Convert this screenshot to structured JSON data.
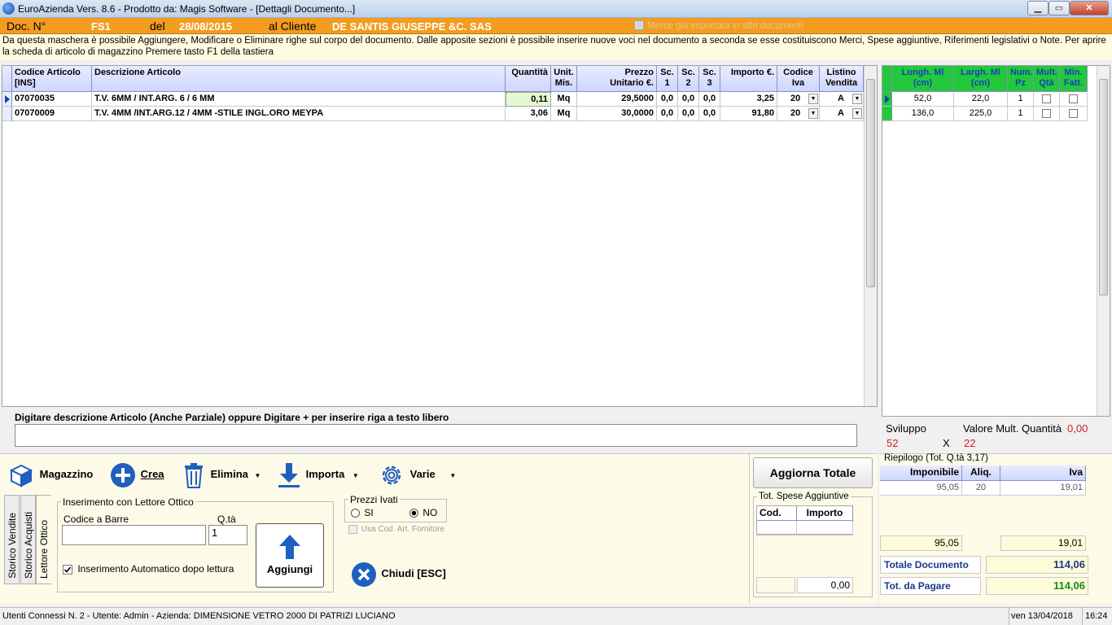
{
  "window": {
    "title": "EuroAzienda Vers. 8.6 - Prodotto da: Magis Software - [Dettagli Documento...]",
    "min_glyph": "▁",
    "max_glyph": "▭",
    "close_glyph": "✕"
  },
  "header": {
    "doc_label": "Doc. N°",
    "doc_number": "FS1",
    "del_label": "del",
    "date": "28/08/2015",
    "cliente_label": "al Cliente",
    "cliente": "DE SANTIS GIUSEPPE &C. SAS",
    "merce_label": "Merce già importata in altri documenti"
  },
  "info": "Da questa maschera è possibile Aggiungere, Modificare o Eliminare righe sul corpo del documento. Dalle apposite sezioni è possibile inserire nuove voci nel documento a seconda se esse costituiscono Merci, Spese aggiuntive, Riferimenti legislativi o Note. Per aprire la scheda di articolo di magazzino Premere tasto F1 della tastiera",
  "grid": {
    "headers": {
      "codice": "Codice Articolo\n[INS]",
      "descrizione": "Descrizione Articolo",
      "quantita": "Quantità",
      "unit": "Unit.\nMis.",
      "prezzo": "Prezzo\nUnitario €.",
      "sc1": "Sc.\n1",
      "sc2": "Sc.\n2",
      "sc3": "Sc.\n3",
      "importo": "Importo €.",
      "iva": "Codice\nIva",
      "listino": "Listino\nVendita"
    },
    "rows": [
      {
        "codice": "07070035",
        "descrizione": "T.V. 6MM / INT.ARG. 6 / 6 MM",
        "quantita": "0,11",
        "unit": "Mq",
        "prezzo": "29,5000",
        "sc1": "0,0",
        "sc2": "0,0",
        "sc3": "0,0",
        "importo": "3,25",
        "iva": "20",
        "listino": "A"
      },
      {
        "codice": "07070009",
        "descrizione": "T.V. 4MM /INT.ARG.12 / 4MM -STILE INGL.ORO MEYPA",
        "quantita": "3,06",
        "unit": "Mq",
        "prezzo": "30,0000",
        "sc1": "0,0",
        "sc2": "0,0",
        "sc3": "0,0",
        "importo": "91,80",
        "iva": "20",
        "listino": "A"
      }
    ]
  },
  "dims": {
    "headers": {
      "lungh": "Lungh. Ml\n(cm)",
      "largh": "Largh. Ml\n(cm)",
      "num": "Num.\nPz",
      "multqta": "Mult.\nQtà",
      "minfatt": "Min.\nFatt."
    },
    "rows": [
      {
        "lungh": "52,0",
        "largh": "22,0",
        "num": "1"
      },
      {
        "lungh": "136,0",
        "largh": "225,0",
        "num": "1"
      }
    ]
  },
  "search": {
    "label": "Digitare descrizione Articolo (Anche Parziale) oppure Digitare + per inserire riga a testo libero",
    "value": ""
  },
  "sviluppo": {
    "label": "Sviluppo",
    "valore_label": "Valore Mult. Quantità",
    "valore": "0,00",
    "a": "52",
    "x": "X",
    "b": "22"
  },
  "toolbar": {
    "magazzino": "Magazzino",
    "crea": "Crea",
    "elimina": "Elimina",
    "importa": "Importa",
    "varie": "Varie",
    "caret": "▼"
  },
  "tabs": [
    "Storico Vendite",
    "Storico Acquisti",
    "Lettore Ottico"
  ],
  "lettore": {
    "legend": "Inserimento con Lettore Ottico",
    "codice_label": "Codice a Barre",
    "codice_value": "",
    "qta_label": "Q.tà",
    "qta_value": "1",
    "auto_label": "Inserimento Automatico dopo lettura",
    "aggiungi": "Aggiungi"
  },
  "prezzi": {
    "legend": "Prezzi Ivati",
    "si": "SI",
    "no": "NO",
    "usa_cod": "Usa Cod. Art. Fornitore"
  },
  "chiudi": "Chiudi [ESC]",
  "aggiorna": "Aggiorna Totale",
  "spese": {
    "legend": "Tot. Spese Aggiuntive",
    "cod": "Cod.",
    "importo": "Importo",
    "total": "0,00"
  },
  "riepilogo": {
    "legend": "Riepilogo (Tot. Q.tà 3,17)",
    "imponibile_h": "Imponibile",
    "aliq_h": "Aliq.",
    "iva_h": "Iva",
    "imponibile": "95,05",
    "aliq": "20",
    "iva": "19,01",
    "tot_imponibile": "95,05",
    "tot_iva": "19,01",
    "totale_label": "Totale Documento",
    "totale": "114,06",
    "pagare_label": "Tot. da Pagare",
    "pagare": "114,06"
  },
  "status": {
    "left": "Utenti Connessi N. 2 - Utente: Admin - Azienda: DIMENSIONE VETRO 2000 DI PATRIZI LUCIANO",
    "date": "ven 13/04/2018",
    "time": "16:24"
  },
  "colors": {
    "header_orange": "#f39c1f",
    "grid_header": "#cfd6ff",
    "dims_header": "#22c93a",
    "accent_blue": "#1f5fbf",
    "total_green": "#1a8a1a"
  }
}
